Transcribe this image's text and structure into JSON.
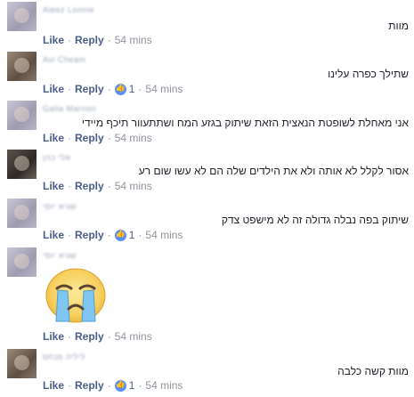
{
  "comments": [
    {
      "name": "Aleez Lonnie",
      "text": "מוות",
      "like": "Like",
      "reply": "Reply",
      "time": "54 mins",
      "reactions": ""
    },
    {
      "name": "Avi Cheam",
      "text": "שתילך כפרה עלינו",
      "like": "Like",
      "reply": "Reply",
      "time": "54 mins",
      "reactions": "1"
    },
    {
      "name": "Galia Marnon",
      "text": "אני מאחלת לשופטת הנאצית הזאת שיתוק בגזע המח ושתתעוור תיכף מיידי",
      "like": "Like",
      "reply": "Reply",
      "time": "54 mins",
      "reactions": ""
    },
    {
      "name": "אלי כהן",
      "text": "אסור לקלל לא אותה ולא את הילדים שלה הם לא עשו שום רע",
      "like": "Like",
      "reply": "Reply",
      "time": "54 mins",
      "reactions": ""
    },
    {
      "name": "שגיא יוסי",
      "text": "שיתוק בפה נבלה גדולה זה לא מישפט צדק",
      "like": "Like",
      "reply": "Reply",
      "time": "54 mins",
      "reactions": "1"
    },
    {
      "name": "שגיא יוסי",
      "text": "",
      "like": "Like",
      "reply": "Reply",
      "time": "54 mins",
      "reactions": ""
    },
    {
      "name": "ליליה פנחס",
      "text": "מוות קשה כלבה",
      "like": "Like",
      "reply": "Reply",
      "time": "54 mins",
      "reactions": "1"
    }
  ],
  "sticker_icon": "crying-face-icon",
  "colors": {
    "link": "#4b5e8a",
    "meta": "#90949c",
    "like_blue": "#5890ff",
    "text": "#1d2129"
  }
}
